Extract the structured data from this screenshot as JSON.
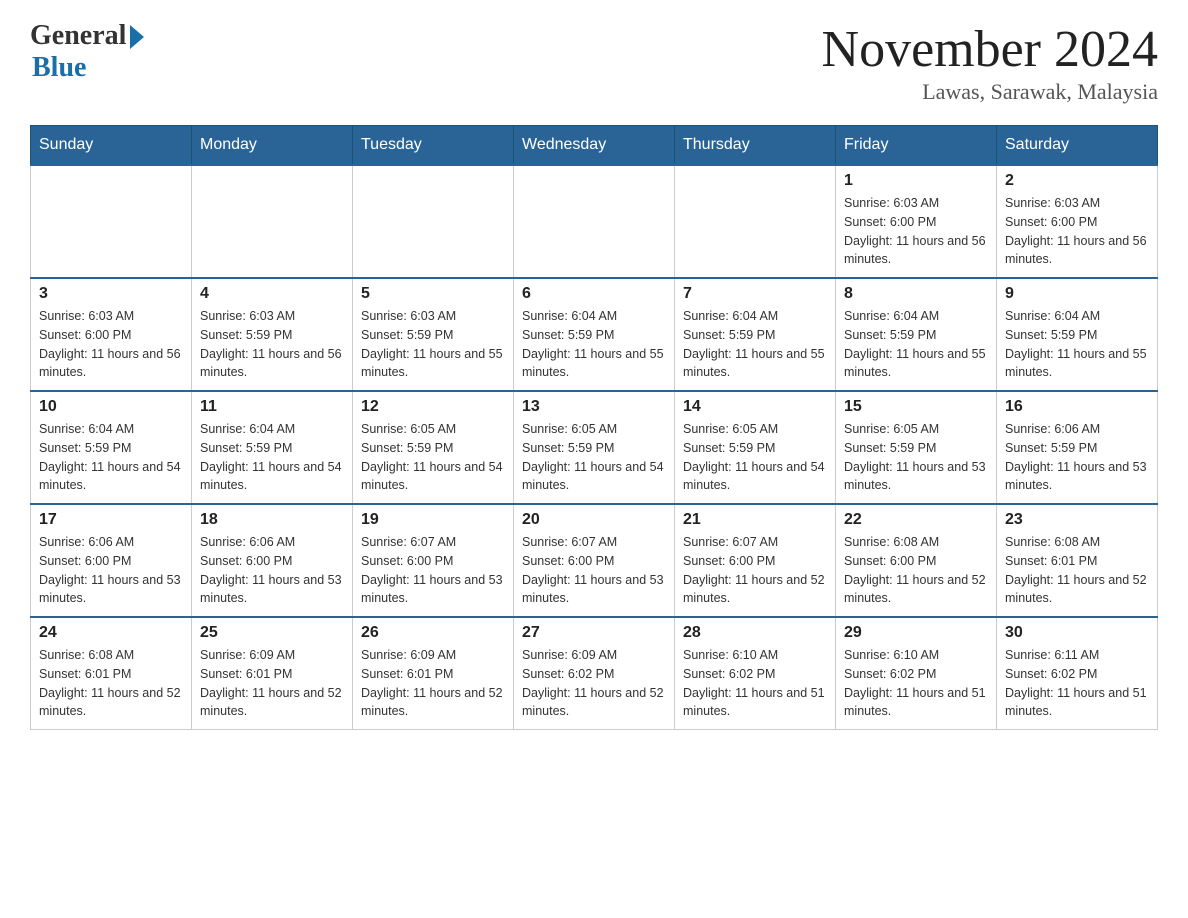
{
  "header": {
    "logo_general": "General",
    "logo_blue": "Blue",
    "month_title": "November 2024",
    "location": "Lawas, Sarawak, Malaysia"
  },
  "weekdays": [
    "Sunday",
    "Monday",
    "Tuesday",
    "Wednesday",
    "Thursday",
    "Friday",
    "Saturday"
  ],
  "weeks": [
    [
      {
        "day": "",
        "sunrise": "",
        "sunset": "",
        "daylight": ""
      },
      {
        "day": "",
        "sunrise": "",
        "sunset": "",
        "daylight": ""
      },
      {
        "day": "",
        "sunrise": "",
        "sunset": "",
        "daylight": ""
      },
      {
        "day": "",
        "sunrise": "",
        "sunset": "",
        "daylight": ""
      },
      {
        "day": "",
        "sunrise": "",
        "sunset": "",
        "daylight": ""
      },
      {
        "day": "1",
        "sunrise": "Sunrise: 6:03 AM",
        "sunset": "Sunset: 6:00 PM",
        "daylight": "Daylight: 11 hours and 56 minutes."
      },
      {
        "day": "2",
        "sunrise": "Sunrise: 6:03 AM",
        "sunset": "Sunset: 6:00 PM",
        "daylight": "Daylight: 11 hours and 56 minutes."
      }
    ],
    [
      {
        "day": "3",
        "sunrise": "Sunrise: 6:03 AM",
        "sunset": "Sunset: 6:00 PM",
        "daylight": "Daylight: 11 hours and 56 minutes."
      },
      {
        "day": "4",
        "sunrise": "Sunrise: 6:03 AM",
        "sunset": "Sunset: 5:59 PM",
        "daylight": "Daylight: 11 hours and 56 minutes."
      },
      {
        "day": "5",
        "sunrise": "Sunrise: 6:03 AM",
        "sunset": "Sunset: 5:59 PM",
        "daylight": "Daylight: 11 hours and 55 minutes."
      },
      {
        "day": "6",
        "sunrise": "Sunrise: 6:04 AM",
        "sunset": "Sunset: 5:59 PM",
        "daylight": "Daylight: 11 hours and 55 minutes."
      },
      {
        "day": "7",
        "sunrise": "Sunrise: 6:04 AM",
        "sunset": "Sunset: 5:59 PM",
        "daylight": "Daylight: 11 hours and 55 minutes."
      },
      {
        "day": "8",
        "sunrise": "Sunrise: 6:04 AM",
        "sunset": "Sunset: 5:59 PM",
        "daylight": "Daylight: 11 hours and 55 minutes."
      },
      {
        "day": "9",
        "sunrise": "Sunrise: 6:04 AM",
        "sunset": "Sunset: 5:59 PM",
        "daylight": "Daylight: 11 hours and 55 minutes."
      }
    ],
    [
      {
        "day": "10",
        "sunrise": "Sunrise: 6:04 AM",
        "sunset": "Sunset: 5:59 PM",
        "daylight": "Daylight: 11 hours and 54 minutes."
      },
      {
        "day": "11",
        "sunrise": "Sunrise: 6:04 AM",
        "sunset": "Sunset: 5:59 PM",
        "daylight": "Daylight: 11 hours and 54 minutes."
      },
      {
        "day": "12",
        "sunrise": "Sunrise: 6:05 AM",
        "sunset": "Sunset: 5:59 PM",
        "daylight": "Daylight: 11 hours and 54 minutes."
      },
      {
        "day": "13",
        "sunrise": "Sunrise: 6:05 AM",
        "sunset": "Sunset: 5:59 PM",
        "daylight": "Daylight: 11 hours and 54 minutes."
      },
      {
        "day": "14",
        "sunrise": "Sunrise: 6:05 AM",
        "sunset": "Sunset: 5:59 PM",
        "daylight": "Daylight: 11 hours and 54 minutes."
      },
      {
        "day": "15",
        "sunrise": "Sunrise: 6:05 AM",
        "sunset": "Sunset: 5:59 PM",
        "daylight": "Daylight: 11 hours and 53 minutes."
      },
      {
        "day": "16",
        "sunrise": "Sunrise: 6:06 AM",
        "sunset": "Sunset: 5:59 PM",
        "daylight": "Daylight: 11 hours and 53 minutes."
      }
    ],
    [
      {
        "day": "17",
        "sunrise": "Sunrise: 6:06 AM",
        "sunset": "Sunset: 6:00 PM",
        "daylight": "Daylight: 11 hours and 53 minutes."
      },
      {
        "day": "18",
        "sunrise": "Sunrise: 6:06 AM",
        "sunset": "Sunset: 6:00 PM",
        "daylight": "Daylight: 11 hours and 53 minutes."
      },
      {
        "day": "19",
        "sunrise": "Sunrise: 6:07 AM",
        "sunset": "Sunset: 6:00 PM",
        "daylight": "Daylight: 11 hours and 53 minutes."
      },
      {
        "day": "20",
        "sunrise": "Sunrise: 6:07 AM",
        "sunset": "Sunset: 6:00 PM",
        "daylight": "Daylight: 11 hours and 53 minutes."
      },
      {
        "day": "21",
        "sunrise": "Sunrise: 6:07 AM",
        "sunset": "Sunset: 6:00 PM",
        "daylight": "Daylight: 11 hours and 52 minutes."
      },
      {
        "day": "22",
        "sunrise": "Sunrise: 6:08 AM",
        "sunset": "Sunset: 6:00 PM",
        "daylight": "Daylight: 11 hours and 52 minutes."
      },
      {
        "day": "23",
        "sunrise": "Sunrise: 6:08 AM",
        "sunset": "Sunset: 6:01 PM",
        "daylight": "Daylight: 11 hours and 52 minutes."
      }
    ],
    [
      {
        "day": "24",
        "sunrise": "Sunrise: 6:08 AM",
        "sunset": "Sunset: 6:01 PM",
        "daylight": "Daylight: 11 hours and 52 minutes."
      },
      {
        "day": "25",
        "sunrise": "Sunrise: 6:09 AM",
        "sunset": "Sunset: 6:01 PM",
        "daylight": "Daylight: 11 hours and 52 minutes."
      },
      {
        "day": "26",
        "sunrise": "Sunrise: 6:09 AM",
        "sunset": "Sunset: 6:01 PM",
        "daylight": "Daylight: 11 hours and 52 minutes."
      },
      {
        "day": "27",
        "sunrise": "Sunrise: 6:09 AM",
        "sunset": "Sunset: 6:02 PM",
        "daylight": "Daylight: 11 hours and 52 minutes."
      },
      {
        "day": "28",
        "sunrise": "Sunrise: 6:10 AM",
        "sunset": "Sunset: 6:02 PM",
        "daylight": "Daylight: 11 hours and 51 minutes."
      },
      {
        "day": "29",
        "sunrise": "Sunrise: 6:10 AM",
        "sunset": "Sunset: 6:02 PM",
        "daylight": "Daylight: 11 hours and 51 minutes."
      },
      {
        "day": "30",
        "sunrise": "Sunrise: 6:11 AM",
        "sunset": "Sunset: 6:02 PM",
        "daylight": "Daylight: 11 hours and 51 minutes."
      }
    ]
  ]
}
